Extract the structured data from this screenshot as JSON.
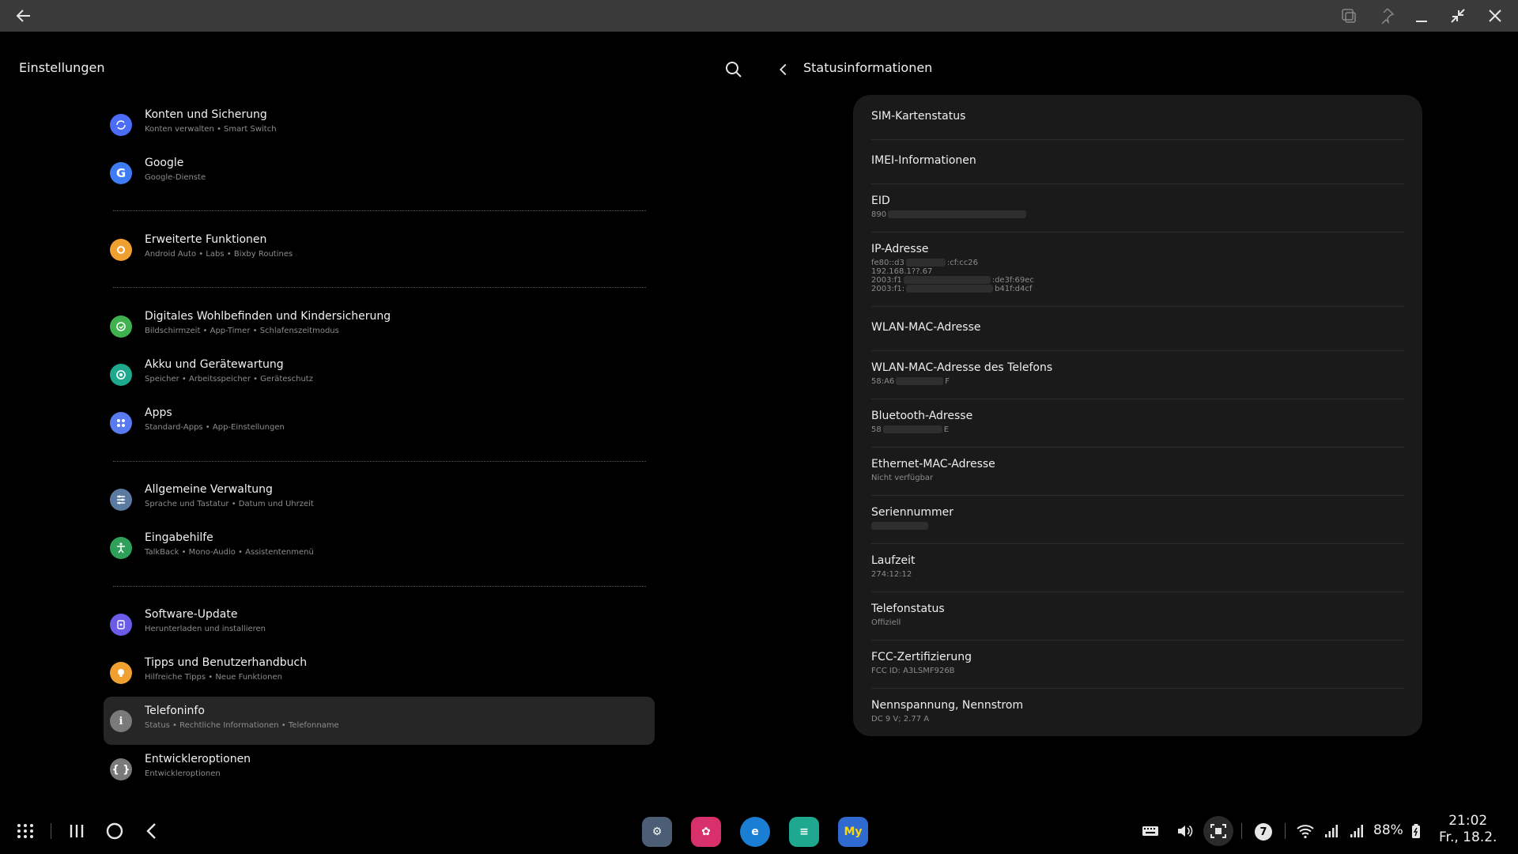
{
  "settings": {
    "title": "Einstellungen",
    "items": [
      {
        "title": "Konten und Sicherung",
        "sub": "Konten verwalten  •  Smart Switch",
        "icon": "sync-icon",
        "color": "#4a6cf7"
      },
      {
        "title": "Google",
        "sub": "Google-Dienste",
        "icon": "google-icon",
        "color": "#3d7cf5"
      },
      {
        "title": "Erweiterte Funktionen",
        "sub": "Android Auto  •  Labs  •  Bixby Routines",
        "icon": "gear-plus-icon",
        "color": "#f0a030"
      },
      {
        "title": "Digitales Wohlbefinden und Kindersicherung",
        "sub": "Bildschirmzeit  •  App-Timer  •  Schlafenszeitmodus",
        "icon": "wellbeing-icon",
        "color": "#3fb24f"
      },
      {
        "title": "Akku und Gerätewartung",
        "sub": "Speicher  •  Arbeitsspeicher  •  Geräteschutz",
        "icon": "device-care-icon",
        "color": "#1ea88e"
      },
      {
        "title": "Apps",
        "sub": "Standard-Apps  •  App-Einstellungen",
        "icon": "apps-icon",
        "color": "#5a7bf0"
      },
      {
        "title": "Allgemeine Verwaltung",
        "sub": "Sprache und Tastatur  •  Datum und Uhrzeit",
        "icon": "sliders-icon",
        "color": "#5b7aa0"
      },
      {
        "title": "Eingabehilfe",
        "sub": "TalkBack  •  Mono-Audio  •  Assistentenmenü",
        "icon": "accessibility-icon",
        "color": "#2ea05a"
      },
      {
        "title": "Software-Update",
        "sub": "Herunterladen und installieren",
        "icon": "update-icon",
        "color": "#6a5ce8"
      },
      {
        "title": "Tipps und Benutzerhandbuch",
        "sub": "Hilfreiche Tipps  •  Neue Funktionen",
        "icon": "lightbulb-icon",
        "color": "#f0a030"
      },
      {
        "title": "Telefoninfo",
        "sub": "Status  •  Rechtliche Informationen  •  Telefonname",
        "icon": "info-icon",
        "color": "#7a7a7a"
      },
      {
        "title": "Entwickleroptionen",
        "sub": "Entwickleroptionen",
        "icon": "braces-icon",
        "color": "#7a7a7a"
      }
    ]
  },
  "status": {
    "title": "Statusinformationen",
    "rows": [
      {
        "title": "SIM-Kartenstatus",
        "lines": []
      },
      {
        "title": "IMEI-Informationen",
        "lines": []
      },
      {
        "title": "EID",
        "lines": [
          "890"
        ]
      },
      {
        "title": "IP-Adresse",
        "lines": [
          "fe80::d3",
          ":cf:cc26",
          "192.168.1??.67",
          "2003:f1",
          ":de3f:69ec",
          "2003:f1:",
          "b41f:d4cf"
        ]
      },
      {
        "title": "WLAN-MAC-Adresse",
        "lines": []
      },
      {
        "title": "WLAN-MAC-Adresse des Telefons",
        "lines": [
          "58:A6",
          "F"
        ]
      },
      {
        "title": "Bluetooth-Adresse",
        "lines": [
          "58",
          "E"
        ]
      },
      {
        "title": "Ethernet-MAC-Adresse",
        "lines": [
          "Nicht verfügbar"
        ]
      },
      {
        "title": "Seriennummer",
        "lines": []
      },
      {
        "title": "Laufzeit",
        "lines": [
          "274:12:12"
        ]
      },
      {
        "title": "Telefonstatus",
        "lines": [
          "Offiziell"
        ]
      },
      {
        "title": "FCC-Zertifizierung",
        "lines": [
          "FCC ID: A3LSMF926B"
        ]
      },
      {
        "title": "Nennspannung, Nennstrom",
        "lines": [
          "DC 9 V; 2.77 A"
        ]
      }
    ]
  },
  "taskbar": {
    "apps": [
      {
        "name": "settings-app-icon",
        "label": "⚙",
        "color": "#4b5e75"
      },
      {
        "name": "flower-app-icon",
        "label": "✿",
        "color": "#d8306a"
      },
      {
        "name": "edge-app-icon",
        "label": "e",
        "color": "#1a7fd4"
      },
      {
        "name": "notes-app-icon",
        "label": "≡",
        "color": "#1fa890"
      },
      {
        "name": "myfritz-app-icon",
        "label": "My",
        "color": "#2e6ad0"
      }
    ],
    "notification_count": "7",
    "battery": "88%",
    "time": "21:02",
    "date": "Fr., 18.2."
  }
}
